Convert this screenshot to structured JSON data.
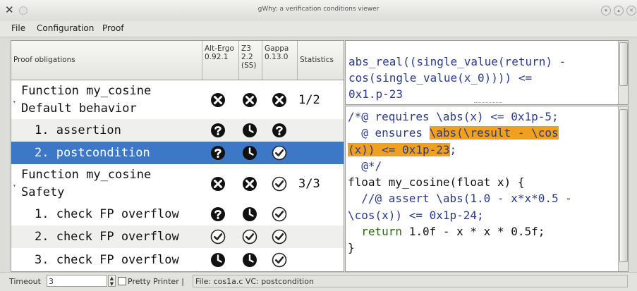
{
  "window": {
    "title": "gWhy: a verification conditions viewer"
  },
  "menubar": [
    {
      "label": "File"
    },
    {
      "label": "Configuration"
    },
    {
      "label": "Proof"
    }
  ],
  "table": {
    "columns": {
      "obligations": "Proof obligations",
      "prover1": "Alt-Ergo\n0.92.1",
      "prover2": "Z3\n2.2\n(SS)",
      "prover3": "Gappa\n0.13.0",
      "statistics": "Statistics"
    },
    "rows": [
      {
        "label": "Function my_cosine\nDefault behavior",
        "icons": [
          "cross",
          "cross",
          "cross"
        ],
        "stat": "1/2"
      },
      {
        "label": "1. assertion",
        "icons": [
          "question",
          "clock",
          "question"
        ],
        "stat": ""
      },
      {
        "label": "2. postcondition",
        "icons": [
          "question",
          "clock",
          "check"
        ],
        "stat": ""
      },
      {
        "label": "Function my_cosine\nSafety",
        "icons": [
          "cross",
          "cross",
          "check"
        ],
        "stat": "3/3"
      },
      {
        "label": "1. check FP overflow",
        "icons": [
          "question",
          "clock",
          "check"
        ],
        "stat": ""
      },
      {
        "label": "2. check FP overflow",
        "icons": [
          "check",
          "check",
          "check"
        ],
        "stat": ""
      },
      {
        "label": "3. check FP overflow",
        "icons": [
          "clock",
          "clock",
          "check"
        ],
        "stat": ""
      }
    ]
  },
  "goal_pane": {
    "text": "abs_real((single_value(return) -\ncos(single_value(x_0)))) <=\n0x1.p-23"
  },
  "source_pane": {
    "l1": "/*@ requires \\abs(x) <= 0x1p-5;",
    "l2a": "  @ ensures ",
    "l2b": "\\abs(\\result - \\cos",
    "l3a": "(x)) <= 0x1p-23",
    "l3b": ";",
    "l4": "  @*/",
    "l5": "float my_cosine(float x) {",
    "l6": "  //@ assert \\abs(1.0 - x*x*0.5 -",
    "l7": "\\cos(x)) <= 0x1p-24;",
    "l8a": "  return",
    "l8b": " 1.0f - x * x * 0.5f;",
    "l9": "}"
  },
  "statusbar": {
    "timeout_label": "Timeout",
    "timeout_value": "3",
    "pretty_printer": "Pretty Printer |",
    "file_info": "File: cos1a.c VC: postcondition"
  }
}
